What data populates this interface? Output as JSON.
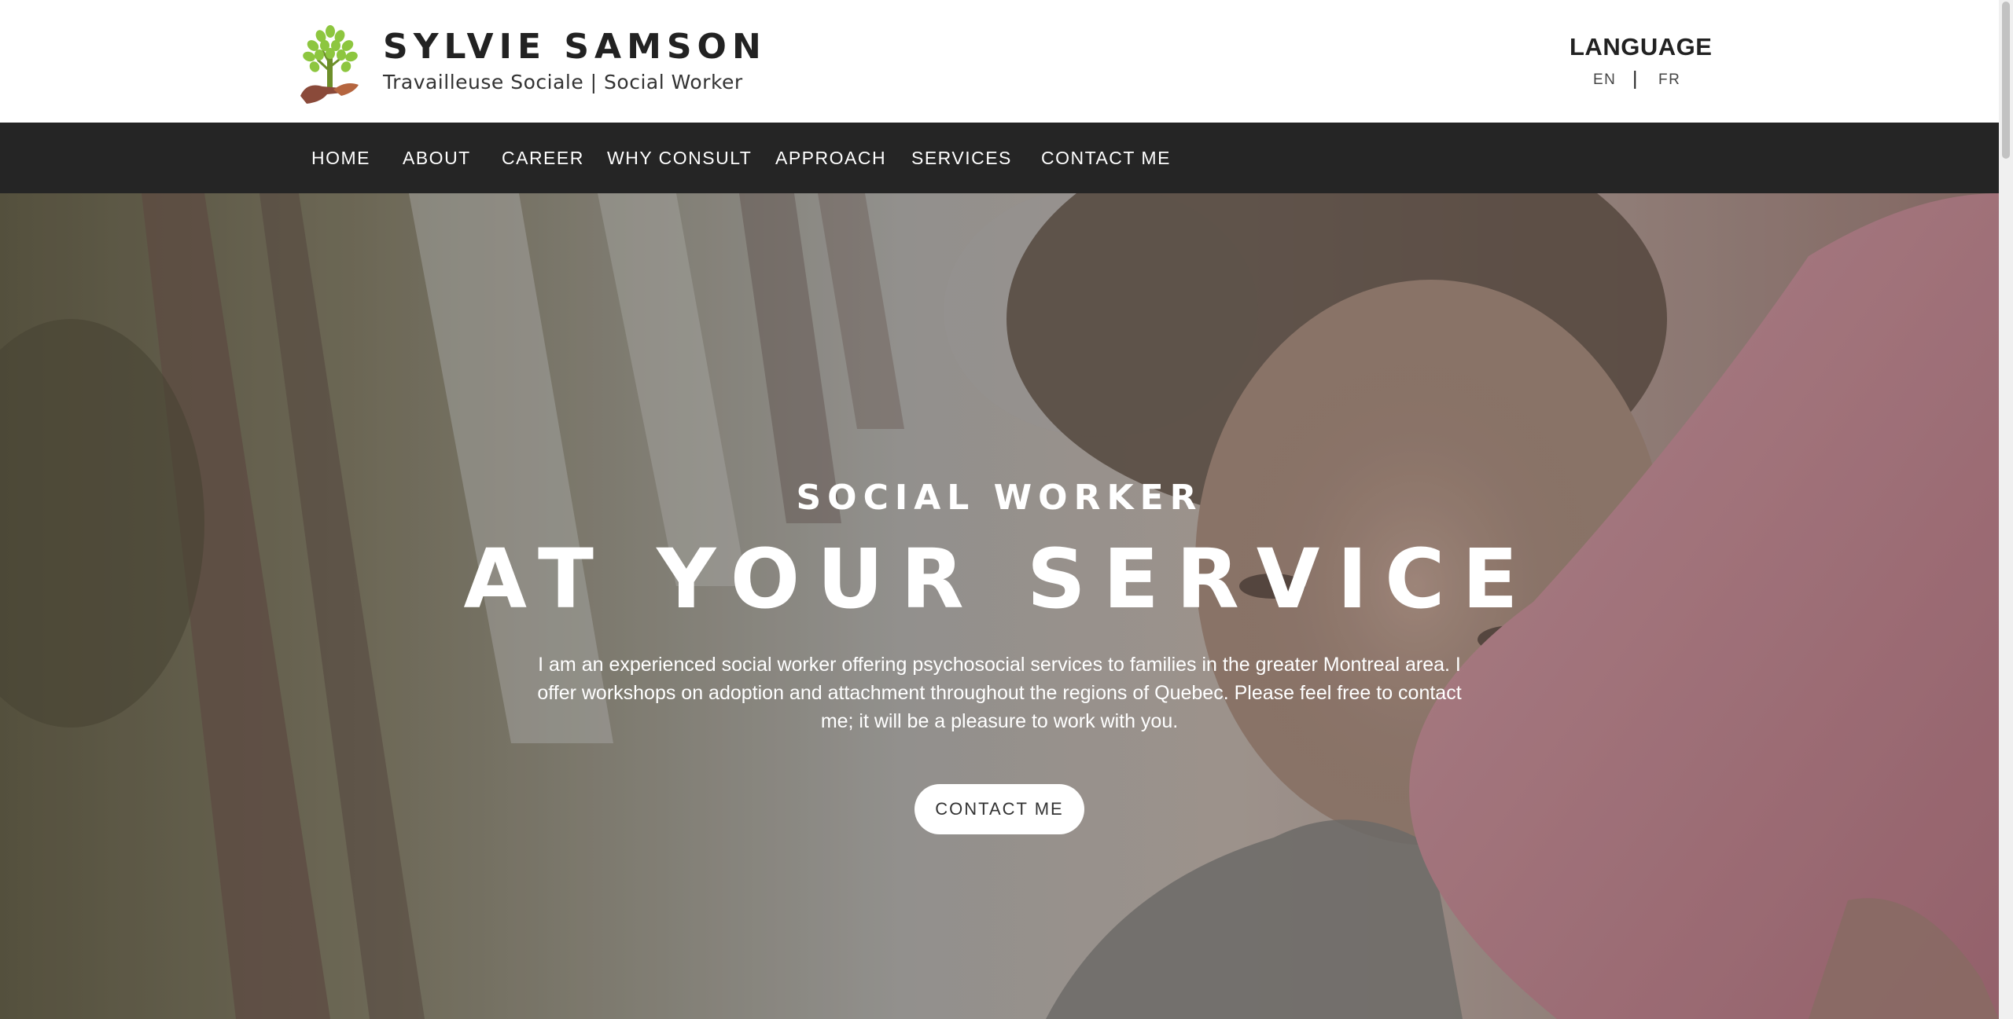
{
  "header": {
    "logo_icon": "tree-in-hands-logo",
    "title": "SYLVIE SAMSON",
    "subtitle": "Travailleuse Sociale | Social Worker",
    "language": {
      "title": "LANGUAGE",
      "options": [
        "EN",
        "FR"
      ],
      "separator": "|"
    }
  },
  "nav": {
    "items": [
      "HOME",
      "ABOUT",
      "CAREER",
      "WHY CONSULT",
      "APPROACH",
      "SERVICES",
      "CONTACT ME"
    ]
  },
  "hero": {
    "eyebrow": "SOCIAL WORKER",
    "title": "AT YOUR SERVICE",
    "text": "I am an experienced social worker offering psychosocial services to families in the greater Montreal area. I offer workshops on adoption and attachment throughout the regions of Quebec. Please feel free to contact me; it will be a pleasure to work with you.",
    "button_label": "CONTACT ME",
    "background": "photo-child-hugging-adult"
  },
  "colors": {
    "nav_background": "#252525",
    "logo_green": "#8dc63f",
    "logo_hand": "#8a4a3a",
    "text_dark": "#222222"
  }
}
